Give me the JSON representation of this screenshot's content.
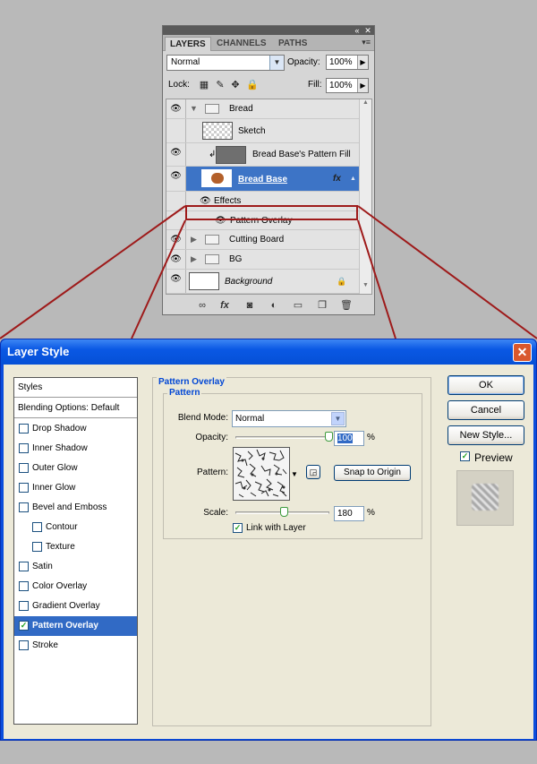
{
  "layers_panel": {
    "tabs": [
      "LAYERS",
      "CHANNELS",
      "PATHS"
    ],
    "blend_mode": "Normal",
    "opacity_label": "Opacity:",
    "opacity_value": "100%",
    "lock_label": "Lock:",
    "fill_label": "Fill:",
    "fill_value": "100%",
    "layers": [
      {
        "name": "Bread",
        "kind": "group",
        "visible": true
      },
      {
        "name": "Sketch",
        "kind": "layer",
        "visible": false
      },
      {
        "name": "Bread Base's Pattern Fill",
        "kind": "layer",
        "visible": true
      },
      {
        "name": "Bread Base",
        "kind": "layer",
        "visible": true,
        "selected": true
      },
      {
        "name": "Effects",
        "kind": "effects",
        "visible": true
      },
      {
        "name": "Pattern Overlay",
        "kind": "effect",
        "visible": true
      },
      {
        "name": "Cutting Board",
        "kind": "group",
        "visible": true
      },
      {
        "name": "BG",
        "kind": "group",
        "visible": true
      },
      {
        "name": "Background",
        "kind": "background",
        "visible": true
      }
    ],
    "footer_icons": [
      "link-icon",
      "fx-icon",
      "mask-icon",
      "adjustment-icon",
      "new-group-icon",
      "new-layer-icon",
      "trash-icon"
    ]
  },
  "dialog": {
    "title": "Layer Style",
    "styles_header": "Styles",
    "blending_options": "Blending Options: Default",
    "style_items": [
      {
        "label": "Drop Shadow",
        "checked": false,
        "indent": false
      },
      {
        "label": "Inner Shadow",
        "checked": false,
        "indent": false
      },
      {
        "label": "Outer Glow",
        "checked": false,
        "indent": false
      },
      {
        "label": "Inner Glow",
        "checked": false,
        "indent": false
      },
      {
        "label": "Bevel and Emboss",
        "checked": false,
        "indent": false
      },
      {
        "label": "Contour",
        "checked": false,
        "indent": true
      },
      {
        "label": "Texture",
        "checked": false,
        "indent": true
      },
      {
        "label": "Satin",
        "checked": false,
        "indent": false
      },
      {
        "label": "Color Overlay",
        "checked": false,
        "indent": false
      },
      {
        "label": "Gradient Overlay",
        "checked": false,
        "indent": false
      },
      {
        "label": "Pattern Overlay",
        "checked": true,
        "indent": false,
        "selected": true
      },
      {
        "label": "Stroke",
        "checked": false,
        "indent": false
      }
    ],
    "section_title": "Pattern Overlay",
    "subsection_title": "Pattern",
    "blend_mode_label": "Blend Mode:",
    "blend_mode_value": "Normal",
    "opacity_label": "Opacity:",
    "opacity_value": "100",
    "opacity_level": 1.0,
    "percent": "%",
    "pattern_label": "Pattern:",
    "snap_button": "Snap to Origin",
    "scale_label": "Scale:",
    "scale_value": "180",
    "scale_level": 0.18,
    "link_label": "Link with Layer",
    "link_checked": true,
    "buttons": {
      "ok": "OK",
      "cancel": "Cancel",
      "new_style": "New Style..."
    },
    "preview_label": "Preview",
    "preview_checked": true
  },
  "colors": {
    "selection_blue": "#316ac5",
    "xp_title_blue": "#0a58e4",
    "callout_red": "#9e1a1a"
  }
}
